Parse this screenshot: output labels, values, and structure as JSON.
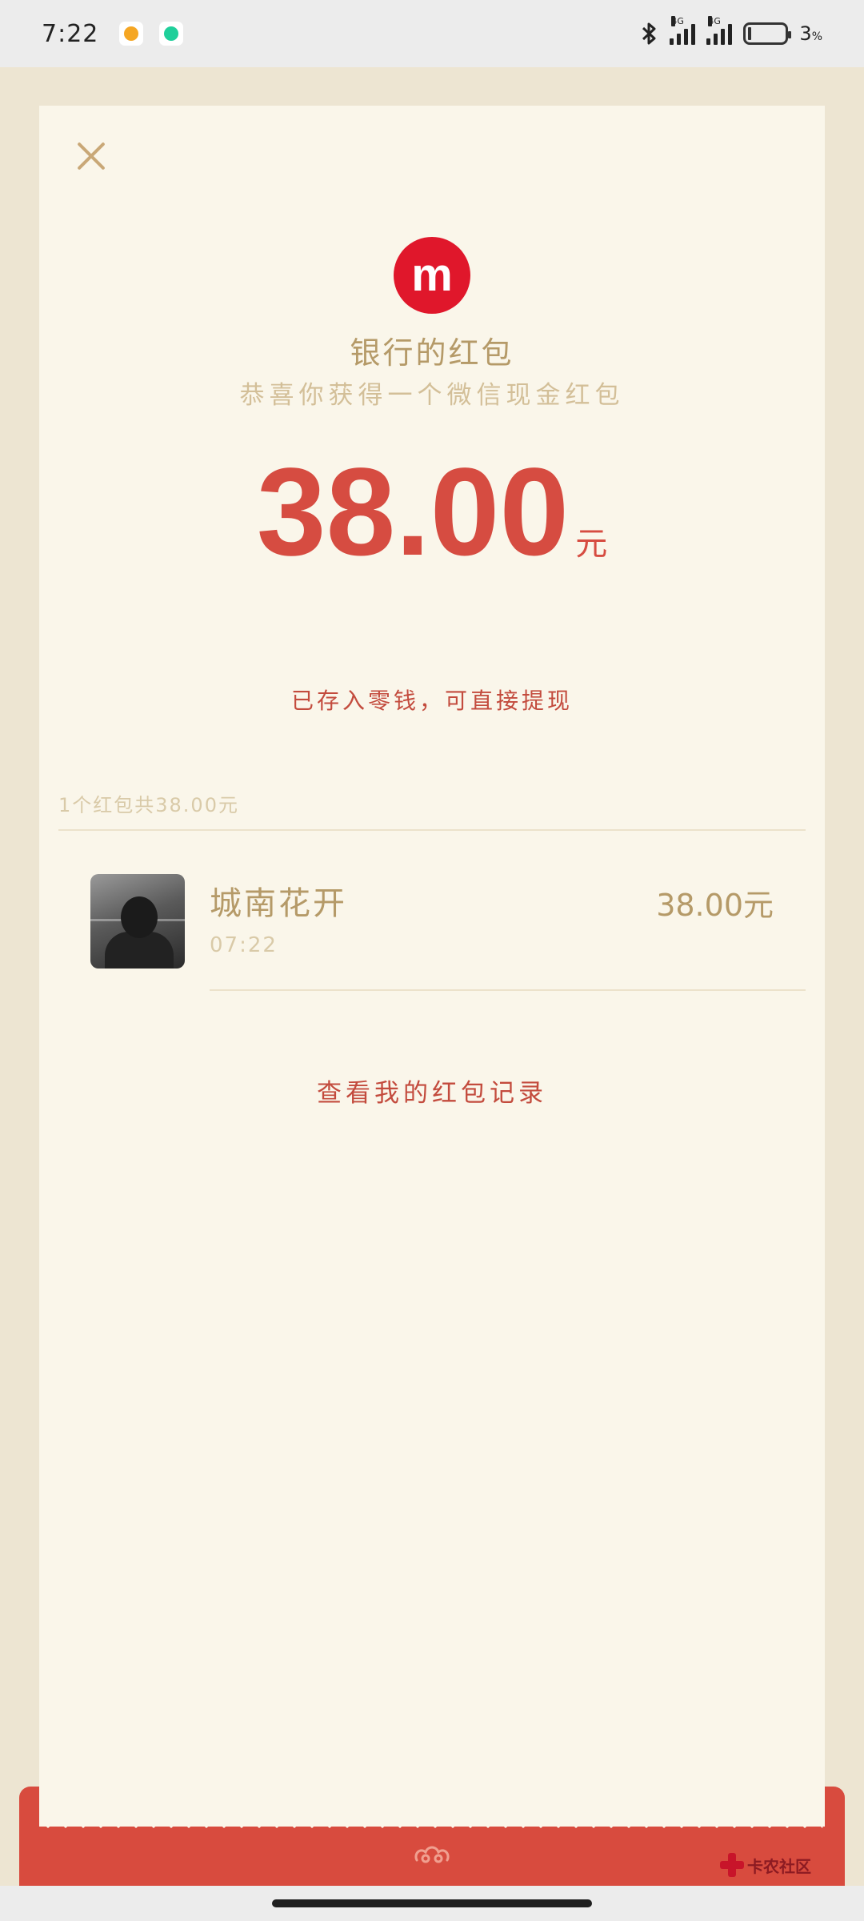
{
  "status_bar": {
    "time": "7:22",
    "network_1": "4G",
    "network_2": "4G",
    "battery_percent": "3"
  },
  "card": {
    "logo_letter": "m",
    "sender_name": "银行的红包",
    "subtitle": "恭喜你获得一个微信现金红包",
    "amount": "38.00",
    "amount_unit": "元",
    "deposit_note": "已存入零钱，可直接提现",
    "summary": "1个红包共38.00元",
    "receiver": {
      "name": "城南花开",
      "time": "07:22",
      "amount": "38.00元"
    },
    "record_link": "查看我的红包记录"
  },
  "watermark": {
    "label": "卡农社区"
  },
  "colors": {
    "accent_red": "#d64c41",
    "gold_text": "#b59a68",
    "card_bg": "#faf6ea",
    "page_bg": "#ede5d2"
  }
}
